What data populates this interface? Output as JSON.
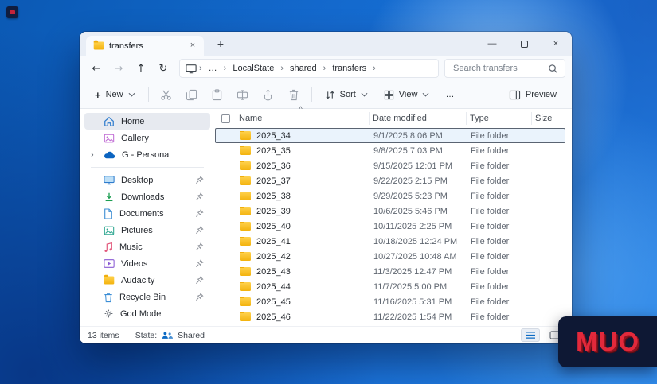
{
  "desktop": {
    "watermark": "MUO"
  },
  "glyphs": {
    "back": "←",
    "forward": "→",
    "up": "↑",
    "refresh": "↻",
    "crumb_sep": "›",
    "overflow": "…",
    "chevron_right": "›",
    "close": "×",
    "plus": "+",
    "minimize": "—",
    "more": "…",
    "sort_ascending": "^"
  },
  "window": {
    "tab": {
      "title": "transfers"
    },
    "breadcrumb": {
      "items": [
        "LocalState",
        "shared",
        "transfers"
      ]
    },
    "search": {
      "placeholder": "Search transfers"
    },
    "toolbar": {
      "new": "New",
      "sort": "Sort",
      "view": "View",
      "preview": "Preview"
    },
    "sidebar": [
      {
        "label": "Home"
      },
      {
        "label": "Gallery"
      },
      {
        "label": "G - Personal"
      },
      {
        "label": "Desktop",
        "pinned": true
      },
      {
        "label": "Downloads",
        "pinned": true
      },
      {
        "label": "Documents",
        "pinned": true
      },
      {
        "label": "Pictures",
        "pinned": true
      },
      {
        "label": "Music",
        "pinned": true
      },
      {
        "label": "Videos",
        "pinned": true
      },
      {
        "label": "Audacity",
        "pinned": true
      },
      {
        "label": "Recycle Bin",
        "pinned": true
      },
      {
        "label": "God Mode"
      }
    ],
    "columns": {
      "name": "Name",
      "date": "Date modified",
      "type": "Type",
      "size": "Size"
    },
    "rows": [
      {
        "name": "2025_34",
        "date": "9/1/2025 8:06 PM",
        "type": "File folder",
        "size": "",
        "selected": true
      },
      {
        "name": "2025_35",
        "date": "9/8/2025 7:03 PM",
        "type": "File folder",
        "size": ""
      },
      {
        "name": "2025_36",
        "date": "9/15/2025 12:01 PM",
        "type": "File folder",
        "size": ""
      },
      {
        "name": "2025_37",
        "date": "9/22/2025 2:15 PM",
        "type": "File folder",
        "size": ""
      },
      {
        "name": "2025_38",
        "date": "9/29/2025 5:23 PM",
        "type": "File folder",
        "size": ""
      },
      {
        "name": "2025_39",
        "date": "10/6/2025 5:46 PM",
        "type": "File folder",
        "size": ""
      },
      {
        "name": "2025_40",
        "date": "10/11/2025 2:25 PM",
        "type": "File folder",
        "size": ""
      },
      {
        "name": "2025_41",
        "date": "10/18/2025 12:24 PM",
        "type": "File folder",
        "size": ""
      },
      {
        "name": "2025_42",
        "date": "10/27/2025 10:48 AM",
        "type": "File folder",
        "size": ""
      },
      {
        "name": "2025_43",
        "date": "11/3/2025 12:47 PM",
        "type": "File folder",
        "size": ""
      },
      {
        "name": "2025_44",
        "date": "11/7/2025 5:00 PM",
        "type": "File folder",
        "size": ""
      },
      {
        "name": "2025_45",
        "date": "11/16/2025 5:31 PM",
        "type": "File folder",
        "size": ""
      },
      {
        "name": "2025_46",
        "date": "11/22/2025 1:54 PM",
        "type": "File folder",
        "size": ""
      }
    ],
    "status": {
      "count": "13 items",
      "state_label": "State:",
      "state_value": "Shared"
    }
  },
  "colors": {
    "accent": "#0f6cbd",
    "selection_fill": "#eaf3fc",
    "selection_border": "#5a6472",
    "folder_yellow": "#ffc83d",
    "watermark_bg": "#0e1834",
    "watermark_red": "#e2293b"
  }
}
